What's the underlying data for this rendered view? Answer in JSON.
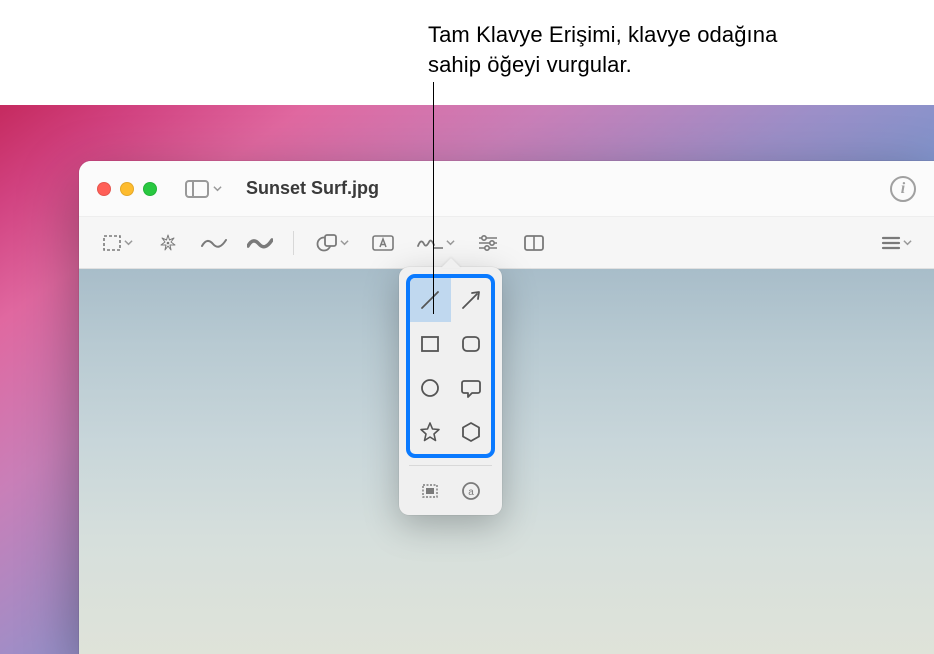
{
  "annotation": {
    "line1": "Tam Klavye Erişimi, klavye odağına",
    "line2": "sahip öğeyi vurgular."
  },
  "window": {
    "filename": "Sunset Surf.jpg"
  },
  "icons": {
    "sidebar": "sidebar-icon",
    "info": "i",
    "select": "selection-icon",
    "instant_alpha": "instant-alpha-icon",
    "sketch": "sketch-icon",
    "draw": "draw-icon",
    "shapes": "shapes-icon",
    "text": "text-icon",
    "sign": "sign-icon",
    "adjust": "adjust-color-icon",
    "crop": "crop-icon",
    "description": "description-icon"
  },
  "shapes": {
    "line": "line-shape",
    "arrow": "arrow-shape",
    "rect": "rectangle-shape",
    "roundrect": "rounded-rectangle-shape",
    "circle": "oval-shape",
    "speech": "speech-bubble-shape",
    "star": "star-shape",
    "hexagon": "hexagon-shape",
    "loupe": "loupe-tool",
    "mask": "mask-tool"
  }
}
